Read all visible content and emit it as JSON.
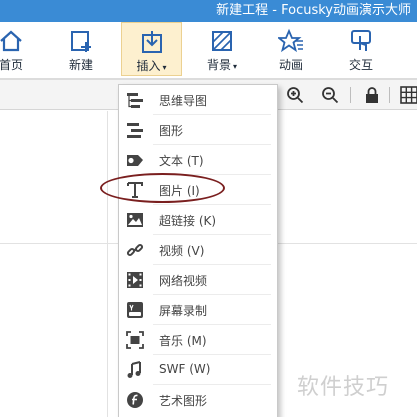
{
  "window": {
    "title": "新建工程 - Focusky动画演示大师"
  },
  "ribbon": {
    "home": "首页",
    "new": "新建",
    "insert": "插入",
    "background": "背景",
    "animation": "动画",
    "interaction": "交互",
    "dropdown_caret": "▾"
  },
  "insert_menu": {
    "items": [
      {
        "label": "思维导图",
        "icon": "mindmap-icon"
      },
      {
        "label": "图形",
        "icon": "shape-icon"
      },
      {
        "label": "文本 (T)",
        "icon": "text-icon"
      },
      {
        "label": "图片 (I)",
        "icon": "image-icon"
      },
      {
        "label": "超链接 (K)",
        "icon": "hyperlink-icon"
      },
      {
        "label": "视频 (V)",
        "icon": "video-icon"
      },
      {
        "label": "网络视频",
        "icon": "web-video-icon"
      },
      {
        "label": "屏幕录制",
        "icon": "screen-record-icon"
      },
      {
        "label": "音乐 (M)",
        "icon": "music-icon"
      },
      {
        "label": "SWF (W)",
        "icon": "swf-icon"
      },
      {
        "label": "艺术图形",
        "icon": "art-shape-icon"
      }
    ]
  },
  "toolbar": {
    "icons": [
      "zoom-in-icon",
      "zoom-out-icon",
      "lock-icon",
      "grid-icon"
    ]
  },
  "colors": {
    "accent": "#3a8bd5",
    "ribbon_icon": "#2a64b0",
    "active_tab_bg": "#fdf0cf",
    "annotation_ellipse": "#7a1f1f"
  },
  "watermark": "软件技巧"
}
